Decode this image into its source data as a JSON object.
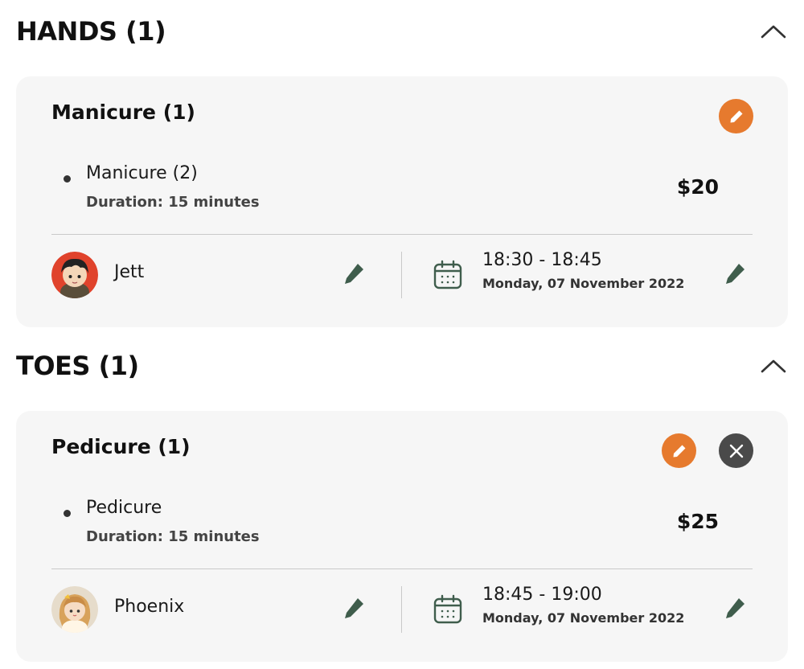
{
  "sections": [
    {
      "title": "HANDS (1)",
      "card": {
        "title": "Manicure (1)",
        "has_remove": false,
        "service": {
          "name": "Manicure (2)",
          "duration": "Duration: 15 minutes",
          "price": "$20"
        },
        "staff": {
          "name": "Jett",
          "avatar": "jett-avatar"
        },
        "time": {
          "range": "18:30 - 18:45",
          "date": "Monday, 07 November 2022"
        }
      }
    },
    {
      "title": "TOES (1)",
      "card": {
        "title": "Pedicure (1)",
        "has_remove": true,
        "service": {
          "name": "Pedicure",
          "duration": "Duration: 15 minutes",
          "price": "$25"
        },
        "staff": {
          "name": "Phoenix",
          "avatar": "phoenix-avatar"
        },
        "time": {
          "range": "18:45 - 19:00",
          "date": "Monday, 07 November 2022"
        }
      }
    }
  ],
  "icons": {
    "collapse": "chevron-up-icon",
    "edit": "pencil-icon",
    "remove": "close-icon",
    "calendar": "calendar-icon"
  },
  "colors": {
    "accent": "#e67a2e",
    "remove": "#4a4a4a",
    "icon_green": "#3f5d4c",
    "card_bg": "#f6f6f6"
  }
}
